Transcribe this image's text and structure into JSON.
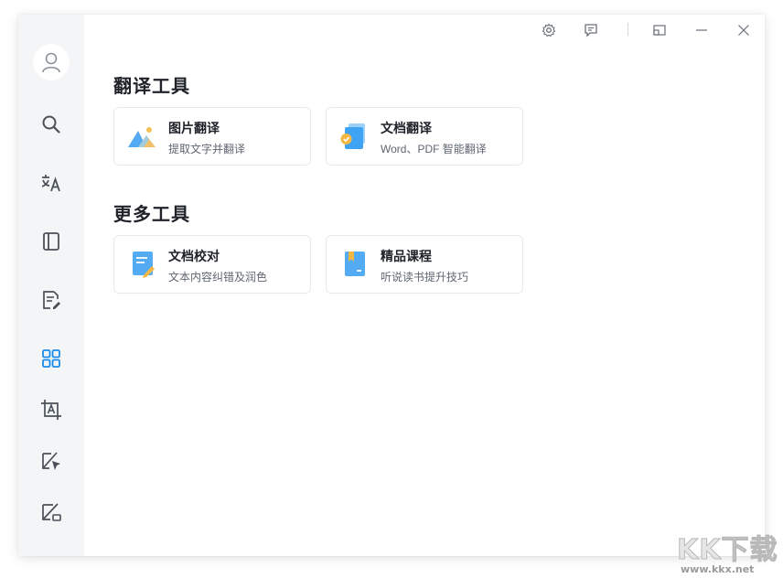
{
  "titlebar": {
    "icons": [
      "gear-icon",
      "feedback-icon",
      "mini-window-icon",
      "minimize-icon",
      "close-icon"
    ]
  },
  "sidebar": {
    "items": [
      {
        "name": "avatar-icon"
      },
      {
        "name": "search-icon"
      },
      {
        "name": "translate-icon"
      },
      {
        "name": "dictionary-icon"
      },
      {
        "name": "document-edit-icon"
      },
      {
        "name": "apps-grid-icon",
        "active": true
      },
      {
        "name": "screenshot-translate-icon"
      },
      {
        "name": "select-translate-icon"
      },
      {
        "name": "image-translate-icon"
      }
    ],
    "active_color": "#1a8cf0"
  },
  "sections": [
    {
      "title": "翻译工具",
      "cards": [
        {
          "title": "图片翻译",
          "subtitle": "提取文字并翻译",
          "icon": "image-translate-icon"
        },
        {
          "title": "文档翻译",
          "subtitle": "Word、PDF 智能翻译",
          "icon": "document-translate-icon"
        }
      ]
    },
    {
      "title": "更多工具",
      "cards": [
        {
          "title": "文档校对",
          "subtitle": "文本内容纠错及润色",
          "icon": "proofread-icon"
        },
        {
          "title": "精品课程",
          "subtitle": "听说读书提升技巧",
          "icon": "course-book-icon"
        }
      ]
    }
  ],
  "watermark": {
    "text": "KK下载",
    "url": "www.kkx.net"
  }
}
